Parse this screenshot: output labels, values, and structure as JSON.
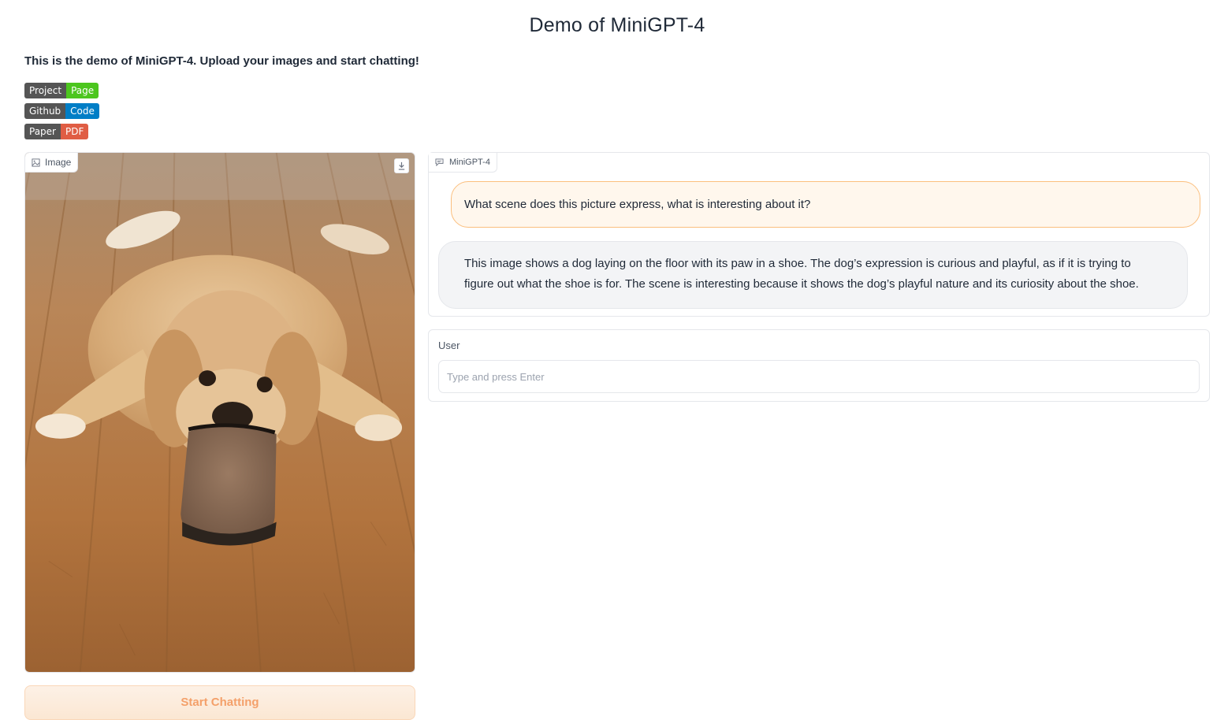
{
  "header": {
    "title": "Demo of MiniGPT-4",
    "description": "This is the demo of MiniGPT-4. Upload your images and start chatting!"
  },
  "badges": [
    {
      "left": "Project",
      "right": "Page",
      "color": "#4cc61e"
    },
    {
      "left": "Github",
      "right": "Code",
      "color": "#007ec6"
    },
    {
      "left": "Paper",
      "right": "PDF",
      "color": "#e05d44"
    }
  ],
  "image_panel": {
    "label": "Image",
    "icons": [
      "image-icon",
      "download-icon"
    ]
  },
  "start_button": {
    "label": "Start Chatting"
  },
  "chatbot": {
    "label": "MiniGPT-4",
    "messages": [
      {
        "role": "user",
        "text": "What scene does this picture express, what is interesting about it?"
      },
      {
        "role": "bot",
        "text": "This image shows a dog laying on the floor with its paw in a shoe. The dog’s expression is curious and playful, as if it is trying to figure out what the shoe is for. The scene is interesting because it shows the dog’s playful nature and its curiosity about the shoe."
      }
    ]
  },
  "user_input": {
    "label": "User",
    "placeholder": "Type and press Enter",
    "value": ""
  },
  "colors": {
    "accent": "#f97316",
    "user_bubble": "#fff7ed",
    "bot_bubble": "#f3f4f6"
  }
}
